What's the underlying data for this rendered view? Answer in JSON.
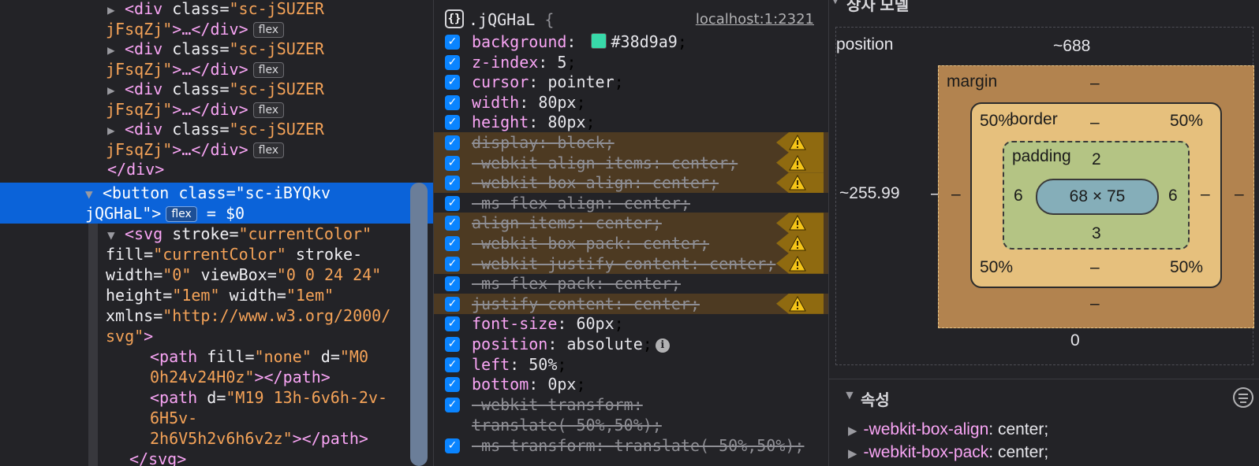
{
  "dom_tree": {
    "collapsed_divs": [
      {
        "open_tag": "<div",
        "attr_name": "class",
        "attr_value_line1": "\"sc-jSUZER",
        "attr_value_line2": "jFsqZj\"",
        "close": ">…</div>",
        "badge": "flex"
      },
      {
        "open_tag": "<div",
        "attr_name": "class",
        "attr_value_line1": "\"sc-jSUZER",
        "attr_value_line2": "jFsqZj\"",
        "close": ">…</div>",
        "badge": "flex"
      },
      {
        "open_tag": "<div",
        "attr_name": "class",
        "attr_value_line1": "\"sc-jSUZER",
        "attr_value_line2": "jFsqZj\"",
        "close": ">…</div>",
        "badge": "flex"
      },
      {
        "open_tag": "<div",
        "attr_name": "class",
        "attr_value_line1": "\"sc-jSUZER",
        "attr_value_line2": "jFsqZj\"",
        "close": ">…</div>",
        "badge": "flex"
      }
    ],
    "closing_div": "</div>",
    "selected": {
      "open_tag": "<button",
      "attr_name": "class",
      "attr_value_line1": "\"sc-iBYQkv",
      "attr_value_line2": "jQGHaL\"",
      "close": ">",
      "badge": "flex",
      "dollar": " = $0"
    },
    "svg": {
      "open_tag": "<svg",
      "line1_attr": "stroke",
      "line1_val": "\"currentColor\"",
      "line2_attr": "fill",
      "line2_val": "\"currentColor\"",
      "line2_attr2": "stroke-",
      "line3_attr": "width",
      "line3_val": "\"0\"",
      "line3_attr2": "viewBox",
      "line3_val2": "\"0 0 24 24\"",
      "line4_attr": "height",
      "line4_val": "\"1em\"",
      "line4_attr2": "width",
      "line4_val2": "\"1em\"",
      "line5_attr": "xmlns",
      "line5_val": "\"http://www.w3.org/2000/",
      "line6_val": "svg\"",
      "line6_close": ">"
    },
    "path1": {
      "open_tag": "<path",
      "attr": "fill",
      "val": "\"none\"",
      "attr2": "d",
      "val2a": "\"M0",
      "val2b": "0h24v24H0z\"",
      "close": "></path>"
    },
    "path2": {
      "open_tag": "<path",
      "attr": "d",
      "val_a": "\"M19 13h-6v6h-2v-",
      "val_b": "6H5v-",
      "val_c": "2h6V5h2v6h6v2z\"",
      "close": "></path>"
    },
    "svg_close": "</svg>"
  },
  "rules": {
    "selector": ".jQGHaL",
    "open_brace": "{",
    "source": "localhost:1:2321",
    "declarations": [
      {
        "name": "background",
        "value": "#38d9a9",
        "swatch": "#38d9a9",
        "struck": false,
        "warning": false
      },
      {
        "name": "z-index",
        "value": "5",
        "struck": false,
        "warning": false
      },
      {
        "name": "cursor",
        "value": "pointer",
        "struck": false,
        "warning": false
      },
      {
        "name": "width",
        "value": "80px",
        "struck": false,
        "warning": false
      },
      {
        "name": "height",
        "value": "80px",
        "struck": false,
        "warning": false
      },
      {
        "name": "display",
        "value": "block",
        "struck": true,
        "warning": true
      },
      {
        "name": "-webkit-align-items",
        "value": "center",
        "struck": true,
        "warning": true
      },
      {
        "name": "-webkit-box-align",
        "value": "center",
        "struck": true,
        "warning": true
      },
      {
        "name": "-ms-flex-align",
        "value": "center",
        "struck": true,
        "warning": false
      },
      {
        "name": "align-items",
        "value": "center",
        "struck": true,
        "warning": true
      },
      {
        "name": "-webkit-box-pack",
        "value": "center",
        "struck": true,
        "warning": true
      },
      {
        "name": "-webkit-justify-content",
        "value": "center",
        "struck": true,
        "warning": true
      },
      {
        "name": "-ms-flex-pack",
        "value": "center",
        "struck": true,
        "warning": false
      },
      {
        "name": "justify-content",
        "value": "center",
        "struck": true,
        "warning": true
      },
      {
        "name": "font-size",
        "value": "60px",
        "struck": false,
        "warning": false
      },
      {
        "name": "position",
        "value": "absolute",
        "struck": false,
        "warning": false,
        "info": true
      },
      {
        "name": "left",
        "value": "50%",
        "struck": false,
        "warning": false
      },
      {
        "name": "bottom",
        "value": "0px",
        "struck": false,
        "warning": false
      },
      {
        "name": "-webkit-transform",
        "value": "translate(-50%,50%)",
        "struck": true,
        "warning": false
      },
      {
        "name": "-ms-transform",
        "value": "translate(-50%,50%)",
        "struck": true,
        "warning": false
      }
    ]
  },
  "box_model": {
    "section_title": "상자 모델",
    "position_label": "position",
    "position_top": "~688",
    "position_left": "~255.99",
    "position_bottom": "0",
    "position_right": "–",
    "margin_label": "margin",
    "margin_top": "–",
    "margin_bottom": "–",
    "margin_left": "–",
    "margin_right": "–",
    "border_label": "border",
    "border_top": "–",
    "border_bottom": "–",
    "border_left": "–",
    "border_right": "–",
    "radius_tl": "50%",
    "radius_tr": "50%",
    "radius_bl": "50%",
    "radius_br": "50%",
    "padding_label": "padding",
    "padding_top": "2",
    "padding_bottom": "3",
    "padding_left": "6",
    "padding_right": "6",
    "content_size": "68 × 75"
  },
  "properties": {
    "title": "속성",
    "items": [
      {
        "name": "-webkit-box-align",
        "value": "center"
      },
      {
        "name": "-webkit-box-pack",
        "value": "center"
      }
    ]
  },
  "colors": {
    "selection": "#0b63d9",
    "swatch": "#38d9a9",
    "warning": "#f5c518"
  },
  "icons": [
    "collapsed-triangle-icon",
    "expanded-triangle-icon",
    "braces-icon",
    "checkbox-icon",
    "warning-icon",
    "info-icon",
    "filter-icon"
  ]
}
